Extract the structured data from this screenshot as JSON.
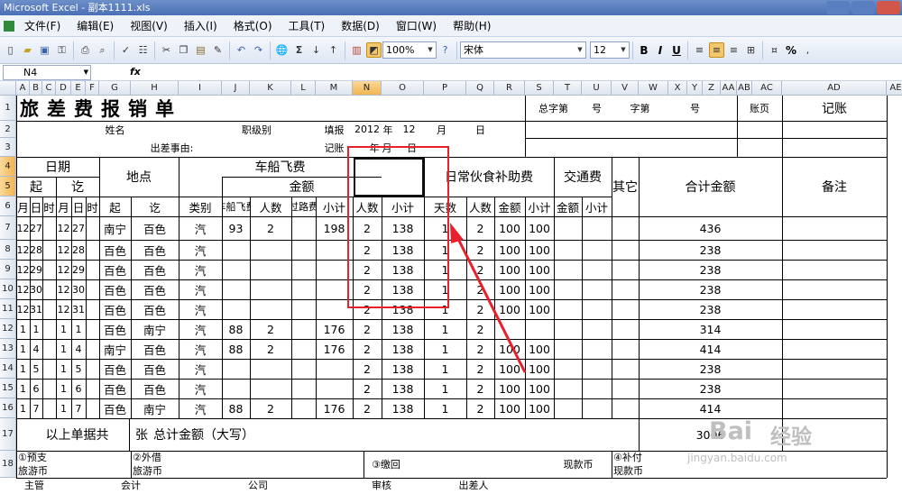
{
  "app": {
    "window_title": "Microsoft Excel - 副本1111.xls"
  },
  "menu": [
    "文件(F)",
    "编辑(E)",
    "视图(V)",
    "插入(I)",
    "格式(O)",
    "工具(T)",
    "数据(D)",
    "窗口(W)",
    "帮助(H)"
  ],
  "toolbar": {
    "zoom": "100%",
    "font_name": "宋体",
    "font_size": "12",
    "bold": "B",
    "italic": "I",
    "underline": "U",
    "percent": "%",
    "sigma": "Σ"
  },
  "formula_bar": {
    "name_box": "N4",
    "fx_label": "fx",
    "content": ""
  },
  "columns": [
    "A",
    "B",
    "C",
    "D",
    "E",
    "F",
    "G",
    "H",
    "I",
    "J",
    "K",
    "L",
    "M",
    "N",
    "O",
    "P",
    "Q",
    "R",
    "S",
    "T",
    "U",
    "V",
    "W",
    "X",
    "Y",
    "Z",
    "AA",
    "AB",
    "AC",
    "AD",
    "AE"
  ],
  "rows": [
    "1",
    "2",
    "3",
    "4",
    "5",
    "6",
    "7",
    "8",
    "9",
    "10",
    "11",
    "12",
    "13",
    "14",
    "15",
    "16",
    "17",
    "18"
  ],
  "sheet": {
    "title": "旅差费报销单",
    "r1_total_label": "总字第",
    "r1_hao1": "号",
    "r1_zidi": "字第",
    "r1_hao2": "号",
    "r1_zhangye": "账页",
    "r1_jizhang": "记账",
    "r2_name": "姓名",
    "r2_rank": "职级别",
    "r2_fill": "填报",
    "r2_year_val": "2012",
    "r2_year": "年",
    "r2_month_val": "12",
    "r2_month": "月",
    "r2_day": "日",
    "r3_reason": "出差事由:",
    "r3_jizhang": "记账",
    "r3_year": "年",
    "r3_month": "月",
    "r3_day": "日",
    "h_date": "日期",
    "h_place": "地点",
    "h_vehicle": "车船飞费",
    "h_amount": "金额",
    "h_subsidy": "日常伙食补助费",
    "h_traffic": "交通费",
    "h_other": "其它",
    "h_total": "合计金额",
    "h_note": "备注",
    "h_start": "起",
    "h_end": "讫",
    "h_month": "月",
    "h_day": "日",
    "h_hour": "时",
    "h_place_start": "起",
    "h_place_end": "讫",
    "h_type": "类别",
    "h_fare": "车船飞费",
    "h_people": "人数",
    "h_toll": "过路费",
    "h_subtotal": "小计",
    "h_n_people": "人数",
    "h_o_subtotal": "小计",
    "h_days": "天数",
    "h_q_people": "人数",
    "h_r_amount": "金额",
    "h_s_subtotal": "小计",
    "h_t_amount": "金额",
    "h_u_subtotal": "小计",
    "data_rows": [
      {
        "m1": "12",
        "d1": "27",
        "m2": "12",
        "d2": "27",
        "from": "南宁",
        "to": "百色",
        "type": "汽",
        "fare": "93",
        "people": "2",
        "sub": "198",
        "n": "2",
        "o": "138",
        "p": "1",
        "q": "2",
        "r": "100",
        "s": "100",
        "total": "436"
      },
      {
        "m1": "12",
        "d1": "28",
        "m2": "12",
        "d2": "28",
        "from": "百色",
        "to": "百色",
        "type": "汽",
        "fare": "",
        "people": "",
        "sub": "",
        "n": "2",
        "o": "138",
        "p": "1",
        "q": "2",
        "r": "100",
        "s": "100",
        "total": "238"
      },
      {
        "m1": "12",
        "d1": "29",
        "m2": "12",
        "d2": "29",
        "from": "百色",
        "to": "百色",
        "type": "汽",
        "fare": "",
        "people": "",
        "sub": "",
        "n": "2",
        "o": "138",
        "p": "1",
        "q": "2",
        "r": "100",
        "s": "100",
        "total": "238"
      },
      {
        "m1": "12",
        "d1": "30",
        "m2": "12",
        "d2": "30",
        "from": "百色",
        "to": "百色",
        "type": "汽",
        "fare": "",
        "people": "",
        "sub": "",
        "n": "2",
        "o": "138",
        "p": "1",
        "q": "2",
        "r": "100",
        "s": "100",
        "total": "238"
      },
      {
        "m1": "12",
        "d1": "31",
        "m2": "12",
        "d2": "31",
        "from": "百色",
        "to": "百色",
        "type": "汽",
        "fare": "",
        "people": "",
        "sub": "",
        "n": "2",
        "o": "138",
        "p": "1",
        "q": "2",
        "r": "100",
        "s": "100",
        "total": "238"
      },
      {
        "m1": "1",
        "d1": "1",
        "m2": "1",
        "d2": "1",
        "from": "百色",
        "to": "南宁",
        "type": "汽",
        "fare": "88",
        "people": "2",
        "sub": "176",
        "n": "2",
        "o": "138",
        "p": "1",
        "q": "2",
        "r": "",
        "s": "",
        "total": "314"
      },
      {
        "m1": "1",
        "d1": "4",
        "m2": "1",
        "d2": "4",
        "from": "南宁",
        "to": "百色",
        "type": "汽",
        "fare": "88",
        "people": "2",
        "sub": "176",
        "n": "2",
        "o": "138",
        "p": "1",
        "q": "2",
        "r": "100",
        "s": "100",
        "total": "414"
      },
      {
        "m1": "1",
        "d1": "5",
        "m2": "1",
        "d2": "5",
        "from": "百色",
        "to": "百色",
        "type": "汽",
        "fare": "",
        "people": "",
        "sub": "",
        "n": "2",
        "o": "138",
        "p": "1",
        "q": "2",
        "r": "100",
        "s": "100",
        "total": "238"
      },
      {
        "m1": "1",
        "d1": "6",
        "m2": "1",
        "d2": "6",
        "from": "百色",
        "to": "百色",
        "type": "汽",
        "fare": "",
        "people": "",
        "sub": "",
        "n": "2",
        "o": "138",
        "p": "1",
        "q": "2",
        "r": "100",
        "s": "100",
        "total": "238"
      },
      {
        "m1": "1",
        "d1": "7",
        "m2": "1",
        "d2": "7",
        "from": "百色",
        "to": "南宁",
        "type": "汽",
        "fare": "88",
        "people": "2",
        "sub": "176",
        "n": "2",
        "o": "138",
        "p": "1",
        "q": "2",
        "r": "100",
        "s": "100",
        "total": "414"
      }
    ],
    "r17_text": "以上单据共",
    "r17_zhang": "张",
    "r17_total": "总计金额（大写）",
    "r17_sum": "3006",
    "r18_prepay": "①预支",
    "r18_prepay_sub": "旅游币",
    "r18_borrow": "②外借",
    "r18_borrow_sub": "旅游币",
    "r18_return": "③缴回",
    "r18_cash": "现款币",
    "r18_supp": "④补付",
    "r18_supp_sub": "现款币",
    "r19_head": "主管",
    "r19_acct": "会计",
    "r19_audit": "公司",
    "r19_review": "审核",
    "r19_traveler": "出差人"
  },
  "watermark": {
    "line1": "Bai",
    "line2": "经验",
    "line3": "jingyan.baidu.com"
  },
  "colors": {
    "titlebar": "#4a6fb5",
    "highlight_box": "#e8202c",
    "selected_header": "#f1b54f"
  }
}
